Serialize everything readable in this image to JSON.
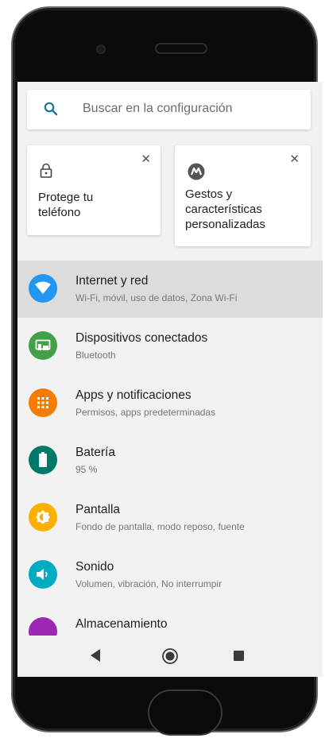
{
  "search": {
    "placeholder": "Buscar en la configuración"
  },
  "suggestions": [
    {
      "label": "Protege tu\nteléfono",
      "icon": "lock-icon"
    },
    {
      "label": "Gestos y\ncaracterísticas\npersonalizadas",
      "icon": "motorola-logo-icon"
    }
  ],
  "settings": [
    {
      "title": "Internet y red",
      "subtitle": "Wi-Fi, móvil, uso de datos, Zona Wi-Fi",
      "icon": "wifi-icon",
      "color": "#2196f3"
    },
    {
      "title": "Dispositivos conectados",
      "subtitle": "Bluetooth",
      "icon": "devices-icon",
      "color": "#43a047"
    },
    {
      "title": "Apps y notificaciones",
      "subtitle": "Permisos, apps predeterminadas",
      "icon": "apps-icon",
      "color": "#f57c00"
    },
    {
      "title": "Batería",
      "subtitle": "95 %",
      "icon": "battery-icon",
      "color": "#00796b"
    },
    {
      "title": "Pantalla",
      "subtitle": "Fondo de pantalla, modo reposo, fuente",
      "icon": "display-icon",
      "color": "#fbb000"
    },
    {
      "title": "Sonido",
      "subtitle": "Volumen, vibración, No interrumpir",
      "icon": "sound-icon",
      "color": "#00acc1"
    },
    {
      "title": "Almacenamiento",
      "subtitle": "",
      "icon": "storage-icon",
      "color": "#9c27b0"
    }
  ],
  "navbar": {
    "back": "back-icon",
    "home": "home-icon",
    "recents": "recents-icon"
  }
}
